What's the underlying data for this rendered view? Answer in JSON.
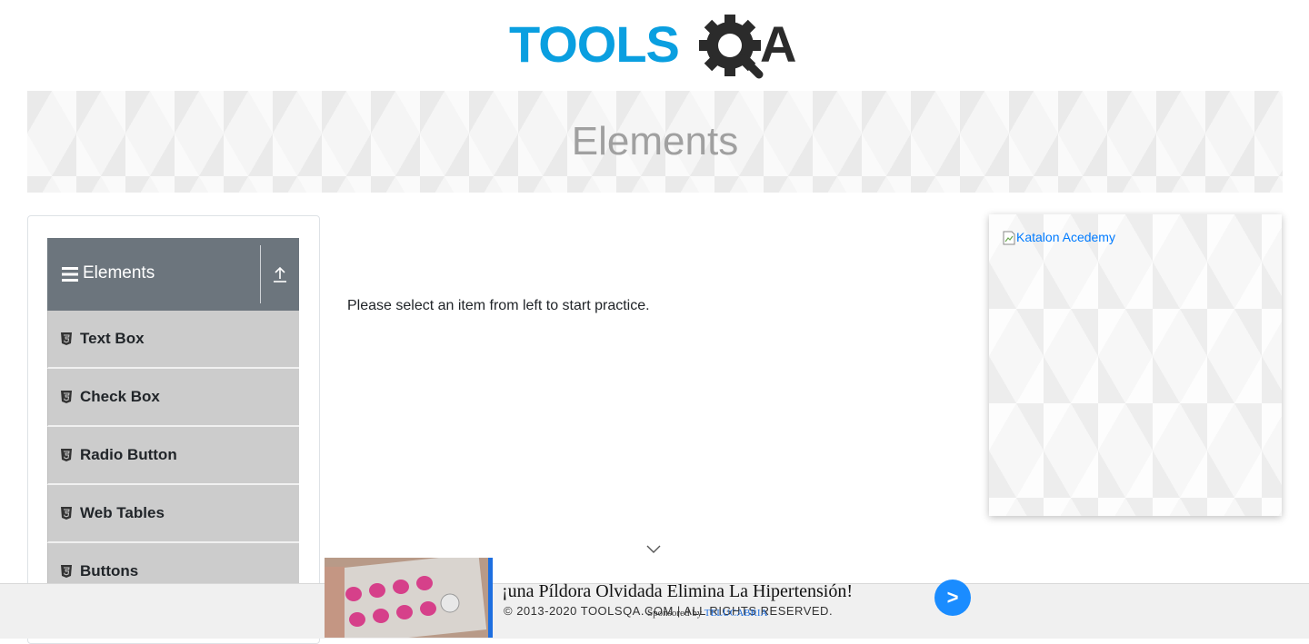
{
  "header": {
    "logo_text_left": "TOOLS",
    "logo_text_right": "A",
    "logo_alt": "ToolsQA logo"
  },
  "banner": {
    "title": "Elements"
  },
  "sidebar": {
    "group_title": "Elements",
    "items": [
      {
        "label": "Text Box"
      },
      {
        "label": "Check Box"
      },
      {
        "label": "Radio Button"
      },
      {
        "label": "Web Tables"
      },
      {
        "label": "Buttons"
      }
    ]
  },
  "main": {
    "instruction": "Please select an item from left to start practice."
  },
  "right_ad": {
    "alt_text": "Katalon Acedemy"
  },
  "footer": {
    "copyright": "© 2013-2020 TOOLSQA.COM | ALL RIGHTS RESERVED."
  },
  "bottom_ad": {
    "headline": "¡una Píldora Olvidada Elimina La Hipertensión!",
    "sponsored_prefix": "Sponsored by",
    "sponsor_name": "TELUCABRIA",
    "go_label": ">"
  },
  "colors": {
    "logo_blue": "#0a9fe0",
    "logo_dark": "#2b2b2b",
    "sidebar_header": "#6c757d",
    "menu_item": "#cccccc",
    "link": "#007bff"
  }
}
